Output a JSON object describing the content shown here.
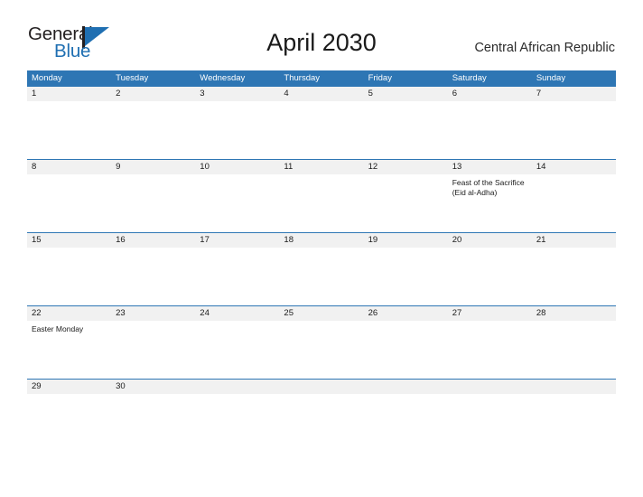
{
  "brand": {
    "name_part1": "General",
    "name_part2": "Blue",
    "triangle_icon": "brand-triangle-icon",
    "accent_color": "#1F6FB2"
  },
  "header": {
    "title": "April 2030",
    "region": "Central African Republic"
  },
  "colors": {
    "header_blue": "#2E76B4",
    "date_band": "#F1F1F1",
    "text": "#1a1a1a",
    "page_background": "#FFFFFF"
  },
  "calendar": {
    "month": "April",
    "year": "2030",
    "week_start": "Monday",
    "day_headers": [
      "Monday",
      "Tuesday",
      "Wednesday",
      "Thursday",
      "Friday",
      "Saturday",
      "Sunday"
    ],
    "weeks": [
      {
        "dates": [
          "1",
          "2",
          "3",
          "4",
          "5",
          "6",
          "7"
        ],
        "events": [
          "",
          "",
          "",
          "",
          "",
          "",
          ""
        ]
      },
      {
        "dates": [
          "8",
          "9",
          "10",
          "11",
          "12",
          "13",
          "14"
        ],
        "events": [
          "",
          "",
          "",
          "",
          "",
          "Feast of the Sacrifice (Eid al-Adha)",
          ""
        ]
      },
      {
        "dates": [
          "15",
          "16",
          "17",
          "18",
          "19",
          "20",
          "21"
        ],
        "events": [
          "",
          "",
          "",
          "",
          "",
          "",
          ""
        ]
      },
      {
        "dates": [
          "22",
          "23",
          "24",
          "25",
          "26",
          "27",
          "28"
        ],
        "events": [
          "Easter Monday",
          "",
          "",
          "",
          "",
          "",
          ""
        ]
      },
      {
        "dates": [
          "29",
          "30",
          "",
          "",
          "",
          "",
          ""
        ],
        "events": [
          "",
          "",
          "",
          "",
          "",
          "",
          ""
        ]
      }
    ]
  }
}
